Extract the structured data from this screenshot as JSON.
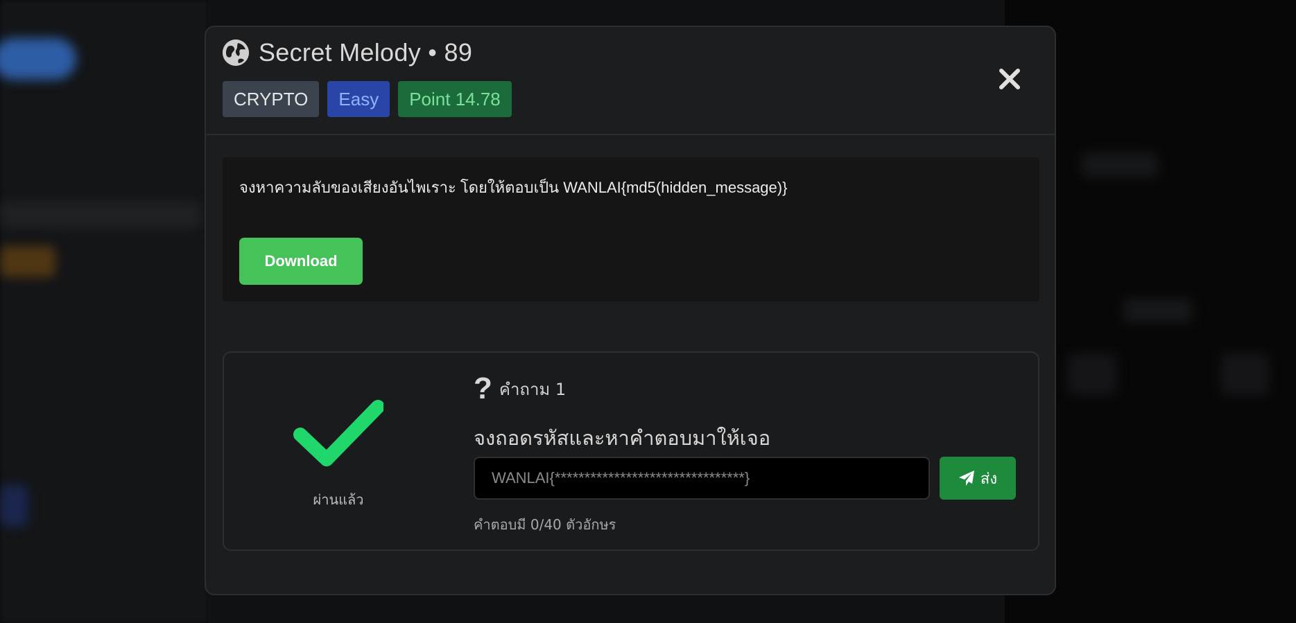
{
  "challenge": {
    "title": "Secret Melody • 89",
    "category": "CRYPTO",
    "difficulty": "Easy",
    "points": "Point 14.78",
    "description": "จงหาความลับของเสียงอันไพเราะ โดยให้ตอบเป็น WANLAI{md5(hidden_message)}",
    "download_label": "Download"
  },
  "question": {
    "number_label": "คำถาม 1",
    "text": "จงถอดรหัสและหาคำตอบมาให้เจอ",
    "answer_value": "WANLAI{********************************}",
    "submit_label": "ส่ง",
    "counter_prefix": "คำตอบมี",
    "counter_value": "0/40",
    "counter_suffix": "ตัวอักษร",
    "status_label": "ผ่านแล้ว"
  },
  "icons": {
    "globe": "globe-icon",
    "close": "close-icon",
    "question": "question-icon",
    "check": "check-icon",
    "send": "paper-plane-icon"
  },
  "colors": {
    "category_badge": "#3b434e",
    "difficulty_badge": "#2a45a8",
    "points_badge": "#1c6b3a",
    "download": "#46c25a",
    "submit": "#1e8a3c",
    "check": "#1fd76a"
  }
}
